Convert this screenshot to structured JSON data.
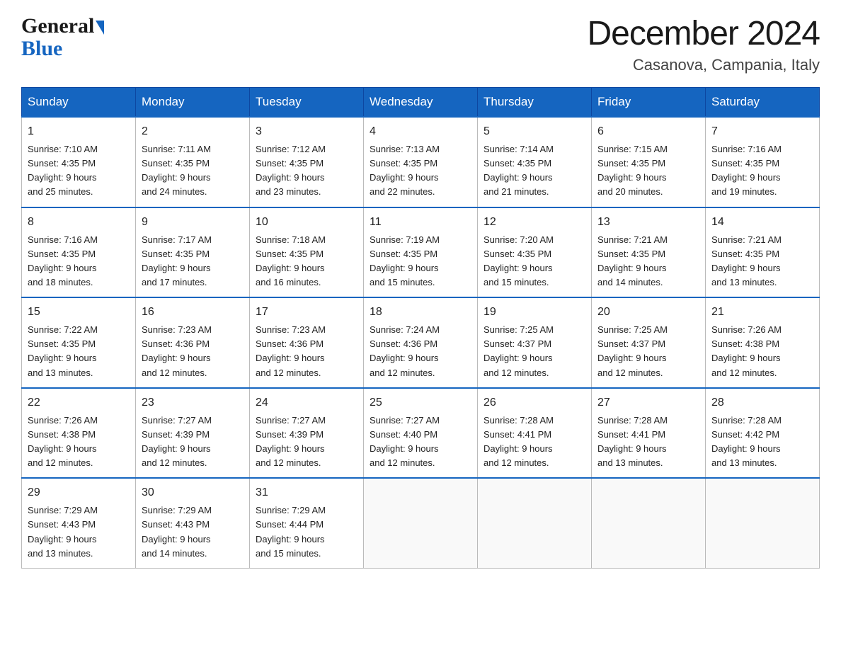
{
  "header": {
    "logo": {
      "general": "General",
      "blue": "Blue"
    },
    "title": "December 2024",
    "location": "Casanova, Campania, Italy"
  },
  "days_of_week": [
    "Sunday",
    "Monday",
    "Tuesday",
    "Wednesday",
    "Thursday",
    "Friday",
    "Saturday"
  ],
  "weeks": [
    [
      {
        "day": "1",
        "sunrise": "7:10 AM",
        "sunset": "4:35 PM",
        "daylight": "9 hours and 25 minutes."
      },
      {
        "day": "2",
        "sunrise": "7:11 AM",
        "sunset": "4:35 PM",
        "daylight": "9 hours and 24 minutes."
      },
      {
        "day": "3",
        "sunrise": "7:12 AM",
        "sunset": "4:35 PM",
        "daylight": "9 hours and 23 minutes."
      },
      {
        "day": "4",
        "sunrise": "7:13 AM",
        "sunset": "4:35 PM",
        "daylight": "9 hours and 22 minutes."
      },
      {
        "day": "5",
        "sunrise": "7:14 AM",
        "sunset": "4:35 PM",
        "daylight": "9 hours and 21 minutes."
      },
      {
        "day": "6",
        "sunrise": "7:15 AM",
        "sunset": "4:35 PM",
        "daylight": "9 hours and 20 minutes."
      },
      {
        "day": "7",
        "sunrise": "7:16 AM",
        "sunset": "4:35 PM",
        "daylight": "9 hours and 19 minutes."
      }
    ],
    [
      {
        "day": "8",
        "sunrise": "7:16 AM",
        "sunset": "4:35 PM",
        "daylight": "9 hours and 18 minutes."
      },
      {
        "day": "9",
        "sunrise": "7:17 AM",
        "sunset": "4:35 PM",
        "daylight": "9 hours and 17 minutes."
      },
      {
        "day": "10",
        "sunrise": "7:18 AM",
        "sunset": "4:35 PM",
        "daylight": "9 hours and 16 minutes."
      },
      {
        "day": "11",
        "sunrise": "7:19 AM",
        "sunset": "4:35 PM",
        "daylight": "9 hours and 15 minutes."
      },
      {
        "day": "12",
        "sunrise": "7:20 AM",
        "sunset": "4:35 PM",
        "daylight": "9 hours and 15 minutes."
      },
      {
        "day": "13",
        "sunrise": "7:21 AM",
        "sunset": "4:35 PM",
        "daylight": "9 hours and 14 minutes."
      },
      {
        "day": "14",
        "sunrise": "7:21 AM",
        "sunset": "4:35 PM",
        "daylight": "9 hours and 13 minutes."
      }
    ],
    [
      {
        "day": "15",
        "sunrise": "7:22 AM",
        "sunset": "4:35 PM",
        "daylight": "9 hours and 13 minutes."
      },
      {
        "day": "16",
        "sunrise": "7:23 AM",
        "sunset": "4:36 PM",
        "daylight": "9 hours and 12 minutes."
      },
      {
        "day": "17",
        "sunrise": "7:23 AM",
        "sunset": "4:36 PM",
        "daylight": "9 hours and 12 minutes."
      },
      {
        "day": "18",
        "sunrise": "7:24 AM",
        "sunset": "4:36 PM",
        "daylight": "9 hours and 12 minutes."
      },
      {
        "day": "19",
        "sunrise": "7:25 AM",
        "sunset": "4:37 PM",
        "daylight": "9 hours and 12 minutes."
      },
      {
        "day": "20",
        "sunrise": "7:25 AM",
        "sunset": "4:37 PM",
        "daylight": "9 hours and 12 minutes."
      },
      {
        "day": "21",
        "sunrise": "7:26 AM",
        "sunset": "4:38 PM",
        "daylight": "9 hours and 12 minutes."
      }
    ],
    [
      {
        "day": "22",
        "sunrise": "7:26 AM",
        "sunset": "4:38 PM",
        "daylight": "9 hours and 12 minutes."
      },
      {
        "day": "23",
        "sunrise": "7:27 AM",
        "sunset": "4:39 PM",
        "daylight": "9 hours and 12 minutes."
      },
      {
        "day": "24",
        "sunrise": "7:27 AM",
        "sunset": "4:39 PM",
        "daylight": "9 hours and 12 minutes."
      },
      {
        "day": "25",
        "sunrise": "7:27 AM",
        "sunset": "4:40 PM",
        "daylight": "9 hours and 12 minutes."
      },
      {
        "day": "26",
        "sunrise": "7:28 AM",
        "sunset": "4:41 PM",
        "daylight": "9 hours and 12 minutes."
      },
      {
        "day": "27",
        "sunrise": "7:28 AM",
        "sunset": "4:41 PM",
        "daylight": "9 hours and 13 minutes."
      },
      {
        "day": "28",
        "sunrise": "7:28 AM",
        "sunset": "4:42 PM",
        "daylight": "9 hours and 13 minutes."
      }
    ],
    [
      {
        "day": "29",
        "sunrise": "7:29 AM",
        "sunset": "4:43 PM",
        "daylight": "9 hours and 13 minutes."
      },
      {
        "day": "30",
        "sunrise": "7:29 AM",
        "sunset": "4:43 PM",
        "daylight": "9 hours and 14 minutes."
      },
      {
        "day": "31",
        "sunrise": "7:29 AM",
        "sunset": "4:44 PM",
        "daylight": "9 hours and 15 minutes."
      },
      null,
      null,
      null,
      null
    ]
  ],
  "labels": {
    "sunrise": "Sunrise:",
    "sunset": "Sunset:",
    "daylight": "Daylight:"
  }
}
